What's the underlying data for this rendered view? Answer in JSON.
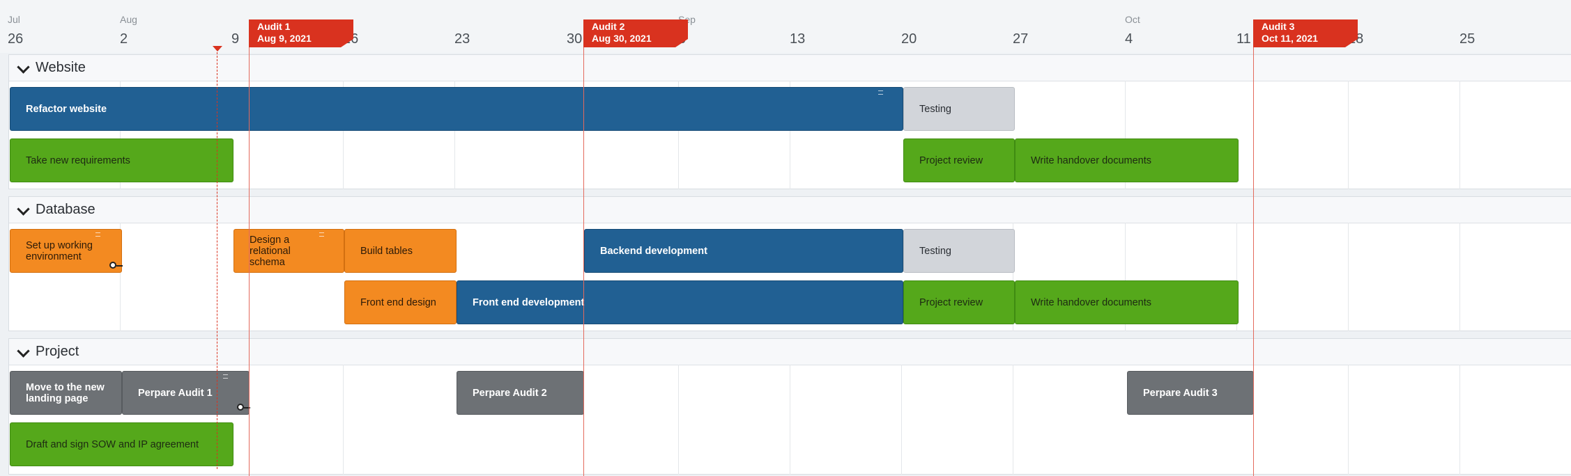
{
  "timeline": {
    "months": [
      "Jul",
      "Aug",
      "Sep",
      "Oct"
    ],
    "days": [
      "26",
      "2",
      "9",
      "16",
      "23",
      "30",
      "6",
      "13",
      "20",
      "27",
      "4",
      "11",
      "18",
      "25"
    ]
  },
  "milestones": [
    {
      "name": "Audit 1",
      "date": "Aug 9, 2021"
    },
    {
      "name": "Audit 2",
      "date": "Aug 30, 2021"
    },
    {
      "name": "Audit 3",
      "date": "Oct 11, 2021"
    }
  ],
  "sections": [
    {
      "title": "Website",
      "rows": [
        [
          {
            "label": "Refactor website",
            "color": "#216093"
          },
          {
            "label": "Testing",
            "color": "#d2d5da"
          }
        ],
        [
          {
            "label": "Take new requirements",
            "color": "#55a81b"
          },
          {
            "label": "Project review",
            "color": "#55a81b"
          },
          {
            "label": "Write handover documents",
            "color": "#55a81b"
          }
        ]
      ]
    },
    {
      "title": "Database",
      "rows": [
        [
          {
            "label": "Set up working environment",
            "color": "#f38a21"
          },
          {
            "label": "Design a relational schema",
            "color": "#f38a21"
          },
          {
            "label": "Build tables",
            "color": "#f38a21"
          },
          {
            "label": "Backend development",
            "color": "#216093"
          },
          {
            "label": "Testing",
            "color": "#d2d5da"
          }
        ],
        [
          {
            "label": "Front end design",
            "color": "#f38a21"
          },
          {
            "label": "Front end development",
            "color": "#216093"
          },
          {
            "label": "Project review",
            "color": "#55a81b"
          },
          {
            "label": "Write handover documents",
            "color": "#55a81b"
          }
        ]
      ]
    },
    {
      "title": "Project",
      "rows": [
        [
          {
            "label": "Move to the new landing page",
            "color": "#6d7175"
          },
          {
            "label": "Perpare Audit 1",
            "color": "#6d7175"
          },
          {
            "label": "Perpare Audit 2",
            "color": "#6d7175"
          },
          {
            "label": "Perpare Audit 3",
            "color": "#6d7175"
          }
        ],
        [
          {
            "label": "Draft and sign SOW and IP agreement",
            "color": "#55a81b"
          }
        ]
      ]
    }
  ]
}
